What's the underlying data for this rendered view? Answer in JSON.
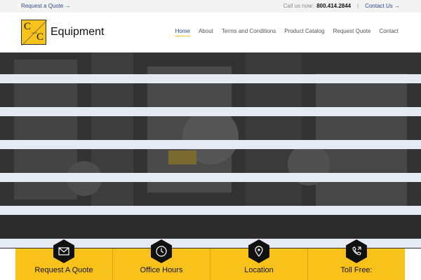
{
  "topbar": {
    "request_quote": "Request a Quote →",
    "call_label": "Call us now:",
    "phone": "800.414.2844",
    "separator": "|",
    "contact": "Contact Us →"
  },
  "logo": {
    "letter_top": "C",
    "letter_bottom": "C",
    "name": "Equipment"
  },
  "nav": {
    "items": [
      {
        "label": "Home"
      },
      {
        "label": "About"
      },
      {
        "label": "Terms and Conditions"
      },
      {
        "label": "Product Catalog"
      },
      {
        "label": "Request Quote"
      },
      {
        "label": "Contact"
      }
    ]
  },
  "info_bar": {
    "items": [
      {
        "label": "Request A Quote",
        "icon": "envelope-icon"
      },
      {
        "label": "Office Hours",
        "icon": "clock-icon"
      },
      {
        "label": "Location",
        "icon": "map-pin-icon"
      },
      {
        "label": "Toll Free:",
        "icon": "phone-icon"
      }
    ]
  },
  "colors": {
    "accent_yellow": "#f9c21b",
    "link_blue": "#2a4a8a",
    "stripe": "#e6ebf3",
    "hero_dark": "#333333"
  }
}
